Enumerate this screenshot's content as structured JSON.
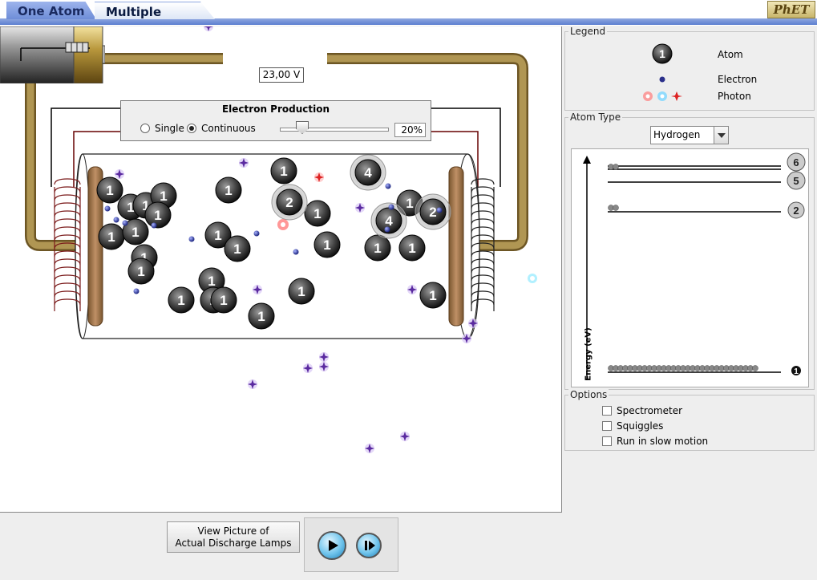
{
  "tabs": [
    {
      "label": "One Atom"
    },
    {
      "label": "Multiple Atoms"
    }
  ],
  "logo": "PhET",
  "battery": {
    "voltage": "23,00 V"
  },
  "electron_production": {
    "title": "Electron Production",
    "single_label": "Single",
    "continuous_label": "Continuous",
    "selected": "Continuous",
    "rate_value": 0.2,
    "rate_text": "20%"
  },
  "legend": {
    "title": "Legend",
    "atom_label": "Atom",
    "electron_label": "Electron",
    "photon_label": "Photon"
  },
  "atom_type": {
    "title": "Atom Type",
    "selected": "Hydrogen",
    "energy_axis_label": "Energy (eV)",
    "level_labels": [
      "1",
      "2",
      "5",
      "6"
    ]
  },
  "options": {
    "title": "Options",
    "items": [
      {
        "label": "Spectrometer",
        "checked": false
      },
      {
        "label": "Squiggles",
        "checked": false
      },
      {
        "label": "Run in slow motion",
        "checked": false
      }
    ]
  },
  "lamps_button": {
    "line1": "View Picture of",
    "line2": "Actual Discharge Lamps"
  },
  "clock": {
    "play_icon": "play-icon",
    "step_icon": "step-icon"
  },
  "tube_atom_labels": [
    "1",
    "1",
    "1",
    "1",
    "1",
    "1",
    "1",
    "1",
    "1",
    "1",
    "1",
    "1",
    "1",
    "1",
    "1",
    "1",
    "1",
    "1",
    "1",
    "1",
    "1",
    "1",
    "1",
    "1",
    "1",
    "2",
    "2",
    "4",
    "4"
  ]
}
